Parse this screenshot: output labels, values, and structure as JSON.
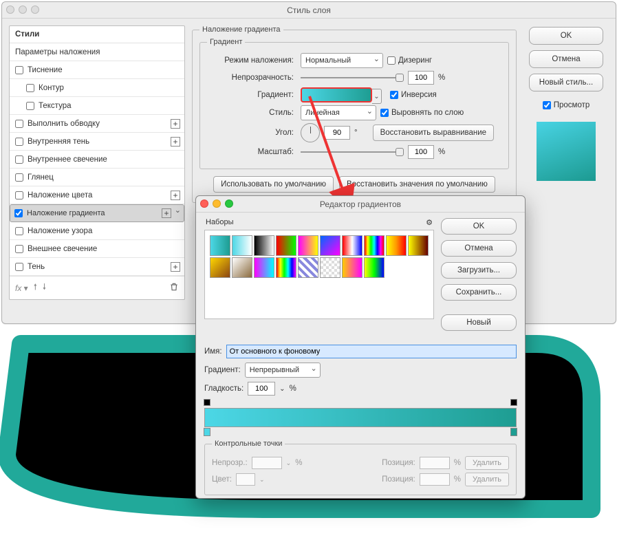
{
  "colors": {
    "accent": "#4cd7e6",
    "accent2": "#1e9d92"
  },
  "main_window": {
    "title": "Стиль слоя",
    "styles_header": "Стили",
    "params_label": "Параметры наложения",
    "items": {
      "emboss": "Тиснение",
      "contour": "Контур",
      "texture": "Текстура",
      "stroke": "Выполнить обводку",
      "inner_shadow": "Внутренняя тень",
      "inner_glow": "Внутреннее свечение",
      "satin": "Глянец",
      "color_overlay": "Наложение цвета",
      "gradient_overlay": "Наложение градиента",
      "pattern_overlay": "Наложение узора",
      "outer_glow": "Внешнее свечение",
      "drop_shadow": "Тень"
    },
    "fx_label": "fx"
  },
  "gradient_panel": {
    "outer_legend": "Наложение градиента",
    "inner_legend": "Градиент",
    "blend_label": "Режим наложения:",
    "blend_value": "Нормальный",
    "dither_label": "Дизеринг",
    "opacity_label": "Непрозрачность:",
    "opacity_value": "100",
    "percent": "%",
    "gradient_label": "Градиент:",
    "reverse_label": "Инверсия",
    "style_label": "Стиль:",
    "style_value": "Линейная",
    "align_label": "Выровнять по слою",
    "angle_label": "Угол:",
    "angle_value": "90",
    "degree": "°",
    "reset_align": "Восстановить выравнивание",
    "scale_label": "Масштаб:",
    "scale_value": "100",
    "make_default": "Использовать по умолчанию",
    "reset_default": "Восстановить значения по умолчанию"
  },
  "right_buttons": {
    "ok": "OK",
    "cancel": "Отмена",
    "new_style": "Новый стиль...",
    "preview": "Просмотр"
  },
  "gradient_editor": {
    "title": "Редактор градиентов",
    "presets_label": "Наборы",
    "ok": "OK",
    "cancel": "Отмена",
    "load": "Загрузить...",
    "save": "Сохранить...",
    "new": "Новый",
    "name_label": "Имя:",
    "name_value": "От основного к фоновому",
    "type_label": "Градиент:",
    "type_value": "Непрерывный",
    "smooth_label": "Гладкость:",
    "smooth_value": "100",
    "percent": "%",
    "stops_legend": "Контрольные точки",
    "opacity_label": "Непрозр.:",
    "color_label": "Цвет:",
    "position_label": "Позиция:",
    "delete": "Удалить",
    "presets": [
      "linear-gradient(90deg,#4cd7e6,#1e9d92)",
      "linear-gradient(90deg,#4cd7e6,transparent)",
      "linear-gradient(90deg,#000,#fff)",
      "linear-gradient(90deg,#f00,#0f0)",
      "linear-gradient(90deg,#f0f,#ff0)",
      "linear-gradient(135deg,#06f,#f0f)",
      "linear-gradient(90deg,#f00,#fff,#00f)",
      "linear-gradient(90deg,#f00,#ff0,#0f0,#0ff,#00f,#f0f,#f00)",
      "linear-gradient(90deg,#ff0,#f90,#f00)",
      "linear-gradient(90deg,#ff0,#600)",
      "linear-gradient(135deg,#ffd700,#8b4513)",
      "linear-gradient(135deg,#fff,#8b6b3e)",
      "linear-gradient(90deg,#f0f,#0ff)",
      "linear-gradient(90deg,#f00,#ff0,#0f0,#0ff,#00f,#f0f)",
      "repeating-linear-gradient(45deg,#88d,#88d 4px,#fff 4px,#fff 8px)",
      "repeating-conic-gradient(#ddd 0 25%,#fff 0 50%)",
      "linear-gradient(90deg,#fc0,#f0f)",
      "linear-gradient(90deg,#ff0,#0f0,#00f)"
    ]
  }
}
